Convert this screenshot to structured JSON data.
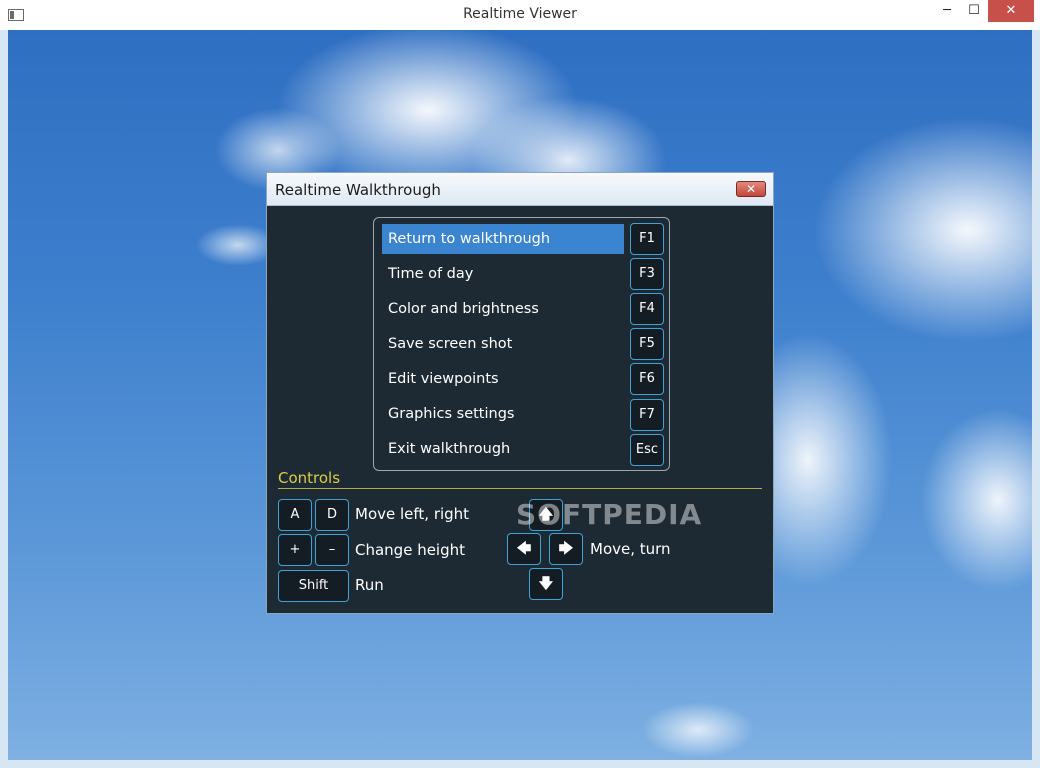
{
  "window": {
    "title": "Realtime Viewer",
    "minimize": "─",
    "maximize": "☐",
    "close": "✕"
  },
  "dialog": {
    "title": "Realtime Walkthrough",
    "close": "✕",
    "menu": [
      {
        "label": "Return to walkthrough",
        "key": "F1",
        "active": true
      },
      {
        "label": "Time of day",
        "key": "F3"
      },
      {
        "label": "Color and brightness",
        "key": "F4"
      },
      {
        "label": "Save screen shot",
        "key": "F5"
      },
      {
        "label": "Edit viewpoints",
        "key": "F6"
      },
      {
        "label": "Graphics settings",
        "key": "F7"
      },
      {
        "label": "Exit walkthrough",
        "key": "Esc"
      }
    ],
    "controls": {
      "heading": "Controls",
      "key_a": "A",
      "key_d": "D",
      "move_left_right": "Move left, right",
      "key_plus": "+",
      "key_minus": "–",
      "change_height": "Change height",
      "key_shift": "Shift",
      "run": "Run",
      "arrow_up": "🡅",
      "arrow_left": "🡄",
      "arrow_right": "🡆",
      "arrow_down": "🡇",
      "move_turn": "Move, turn"
    }
  },
  "watermark": "SOFTPEDIA",
  "colors": {
    "accent": "#3b84cf",
    "key_border": "#3fa3d6",
    "controls_heading": "#d8cf46",
    "dialog_bg": "#1e2a33"
  }
}
